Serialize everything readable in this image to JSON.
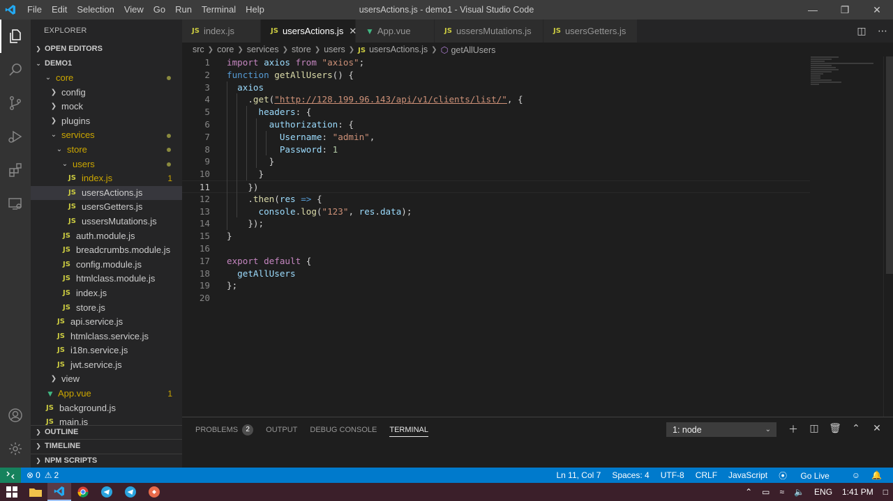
{
  "window": {
    "title": "usersActions.js - demo1 - Visual Studio Code",
    "menu": [
      "File",
      "Edit",
      "Selection",
      "View",
      "Go",
      "Run",
      "Terminal",
      "Help"
    ]
  },
  "sidebar": {
    "title": "EXPLORER",
    "open_editors": "OPEN EDITORS",
    "project": "DEMO1",
    "tree": [
      {
        "label": "core",
        "type": "folder",
        "open": true,
        "level": 1,
        "mark": "dot",
        "color": "yellow"
      },
      {
        "label": "config",
        "type": "folder",
        "open": false,
        "level": 2
      },
      {
        "label": "mock",
        "type": "folder",
        "open": false,
        "level": 2
      },
      {
        "label": "plugins",
        "type": "folder",
        "open": false,
        "level": 2
      },
      {
        "label": "services",
        "type": "folder",
        "open": true,
        "level": 2,
        "mark": "dot",
        "color": "yellow"
      },
      {
        "label": "store",
        "type": "folder",
        "open": true,
        "level": 3,
        "mark": "dot",
        "color": "yellow"
      },
      {
        "label": "users",
        "type": "folder",
        "open": true,
        "level": 4,
        "mark": "dot",
        "color": "yellow"
      },
      {
        "label": "index.js",
        "type": "js",
        "level": 5,
        "badge": "1",
        "color": "yellow"
      },
      {
        "label": "usersActions.js",
        "type": "js",
        "level": 5,
        "selected": true
      },
      {
        "label": "usersGetters.js",
        "type": "js",
        "level": 5
      },
      {
        "label": "ussersMutations.js",
        "type": "js",
        "level": 5
      },
      {
        "label": "auth.module.js",
        "type": "js",
        "level": 4
      },
      {
        "label": "breadcrumbs.module.js",
        "type": "js",
        "level": 4
      },
      {
        "label": "config.module.js",
        "type": "js",
        "level": 4
      },
      {
        "label": "htmlclass.module.js",
        "type": "js",
        "level": 4
      },
      {
        "label": "index.js",
        "type": "js",
        "level": 4
      },
      {
        "label": "store.js",
        "type": "js",
        "level": 4
      },
      {
        "label": "api.service.js",
        "type": "js",
        "level": 3
      },
      {
        "label": "htmlclass.service.js",
        "type": "js",
        "level": 3
      },
      {
        "label": "i18n.service.js",
        "type": "js",
        "level": 3
      },
      {
        "label": "jwt.service.js",
        "type": "js",
        "level": 3
      },
      {
        "label": "view",
        "type": "folder",
        "open": false,
        "level": 2
      },
      {
        "label": "App.vue",
        "type": "vue",
        "level": 1,
        "badge": "1",
        "color": "yellow"
      },
      {
        "label": "background.js",
        "type": "js",
        "level": 1
      },
      {
        "label": "main.js",
        "type": "js",
        "level": 1
      }
    ],
    "bottom_sections": [
      "OUTLINE",
      "TIMELINE",
      "NPM SCRIPTS"
    ]
  },
  "tabs": [
    {
      "label": "index.js",
      "type": "js",
      "active": false
    },
    {
      "label": "usersActions.js",
      "type": "js",
      "active": true
    },
    {
      "label": "App.vue",
      "type": "vue",
      "active": false
    },
    {
      "label": "ussersMutations.js",
      "type": "js",
      "active": false
    },
    {
      "label": "usersGetters.js",
      "type": "js",
      "active": false
    }
  ],
  "breadcrumb": [
    "src",
    "core",
    "services",
    "store",
    "users",
    "usersActions.js",
    "getAllUsers"
  ],
  "code": {
    "current_line": 11,
    "lines": [
      [
        [
          "kw",
          "import"
        ],
        [
          "pl",
          " "
        ],
        [
          "var",
          "axios"
        ],
        [
          "pl",
          " "
        ],
        [
          "kw",
          "from"
        ],
        [
          "pl",
          " "
        ],
        [
          "str",
          "\"axios\""
        ],
        [
          "pl",
          ";"
        ]
      ],
      [
        [
          "kw2",
          "function"
        ],
        [
          "pl",
          " "
        ],
        [
          "fn",
          "getAllUsers"
        ],
        [
          "pl",
          "() {"
        ]
      ],
      [
        [
          "pl",
          "  "
        ],
        [
          "var",
          "axios"
        ]
      ],
      [
        [
          "pl",
          "    ."
        ],
        [
          "fn",
          "get"
        ],
        [
          "pl",
          "("
        ],
        [
          "strlink",
          "\"http://128.199.96.143/api/v1/clients/list/\""
        ],
        [
          "pl",
          ", {"
        ]
      ],
      [
        [
          "pl",
          "      "
        ],
        [
          "var",
          "headers"
        ],
        [
          "pl",
          ": {"
        ]
      ],
      [
        [
          "pl",
          "        "
        ],
        [
          "var",
          "authorization"
        ],
        [
          "pl",
          ": {"
        ]
      ],
      [
        [
          "pl",
          "          "
        ],
        [
          "var",
          "Username"
        ],
        [
          "pl",
          ": "
        ],
        [
          "str",
          "\"admin\""
        ],
        [
          "pl",
          ","
        ]
      ],
      [
        [
          "pl",
          "          "
        ],
        [
          "var",
          "Password"
        ],
        [
          "pl",
          ": "
        ],
        [
          "num",
          "1"
        ]
      ],
      [
        [
          "pl",
          "        }"
        ]
      ],
      [
        [
          "pl",
          "      }"
        ]
      ],
      [
        [
          "pl",
          "    })"
        ]
      ],
      [
        [
          "pl",
          "    ."
        ],
        [
          "fn",
          "then"
        ],
        [
          "pl",
          "("
        ],
        [
          "var",
          "res"
        ],
        [
          "pl",
          " "
        ],
        [
          "kw2",
          "=>"
        ],
        [
          "pl",
          " {"
        ]
      ],
      [
        [
          "pl",
          "      "
        ],
        [
          "var",
          "console"
        ],
        [
          "pl",
          "."
        ],
        [
          "fn",
          "log"
        ],
        [
          "pl",
          "("
        ],
        [
          "str",
          "\"123\""
        ],
        [
          "pl",
          ", "
        ],
        [
          "var",
          "res"
        ],
        [
          "pl",
          "."
        ],
        [
          "var",
          "data"
        ],
        [
          "pl",
          ");"
        ]
      ],
      [
        [
          "pl",
          "    });"
        ]
      ],
      [
        [
          "pl",
          "}"
        ]
      ],
      [],
      [
        [
          "kw",
          "export"
        ],
        [
          "pl",
          " "
        ],
        [
          "kw",
          "default"
        ],
        [
          "pl",
          " {"
        ]
      ],
      [
        [
          "pl",
          "  "
        ],
        [
          "var",
          "getAllUsers"
        ]
      ],
      [
        [
          "pl",
          "};"
        ]
      ],
      []
    ]
  },
  "panel": {
    "tabs": [
      {
        "label": "PROBLEMS",
        "count": "2",
        "active": false
      },
      {
        "label": "OUTPUT",
        "active": false
      },
      {
        "label": "DEBUG CONSOLE",
        "active": false
      },
      {
        "label": "TERMINAL",
        "active": true
      }
    ],
    "terminal_select": "1: node"
  },
  "status": {
    "errors": "0",
    "warnings": "2",
    "position": "Ln 11, Col 7",
    "spaces": "Spaces: 4",
    "encoding": "UTF-8",
    "eol": "CRLF",
    "language": "JavaScript",
    "golive": "Go Live"
  },
  "taskbar": {
    "lang": "ENG",
    "time": "1:41 PM"
  },
  "colors": {
    "accent": "#007acc",
    "titlebar": "#3c3c3c",
    "sidebar": "#252526",
    "editor": "#1e1e1e"
  }
}
